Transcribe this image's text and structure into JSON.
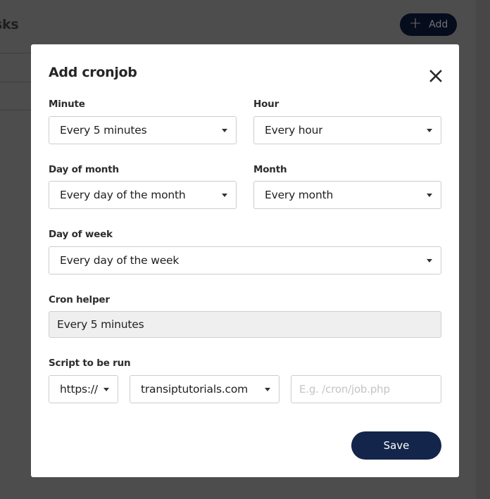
{
  "background": {
    "page_title_fragment": "sks",
    "add_button": {
      "icon": "plus-icon",
      "label": "Add"
    }
  },
  "modal": {
    "title": "Add cronjob",
    "close_icon": "close-icon",
    "fields": {
      "minute": {
        "label": "Minute",
        "value": "Every 5 minutes"
      },
      "hour": {
        "label": "Hour",
        "value": "Every hour"
      },
      "day_of_month": {
        "label": "Day of month",
        "value": "Every day of the month"
      },
      "month": {
        "label": "Month",
        "value": "Every month"
      },
      "day_of_week": {
        "label": "Day of week",
        "value": "Every day of the week"
      },
      "cron_helper": {
        "label": "Cron helper",
        "value": "Every 5 minutes"
      },
      "script": {
        "label": "Script to be run",
        "protocol": "https://",
        "domain": "transiptutorials.com",
        "path_value": "",
        "path_placeholder": "E.g. /cron/job.php"
      }
    },
    "save_label": "Save"
  },
  "colors": {
    "primary": "#13254a",
    "overlay": "#4d4d4d",
    "readonly_bg": "#efefef"
  }
}
